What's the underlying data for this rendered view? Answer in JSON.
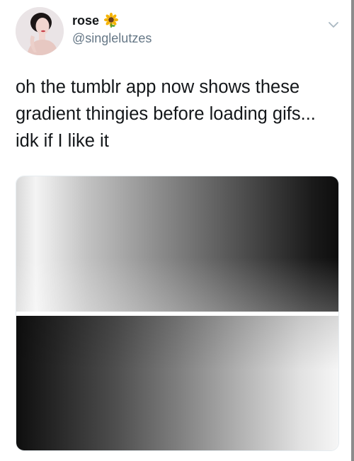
{
  "tweet": {
    "author": {
      "display_name": "rose",
      "name_emoji": "sunflower",
      "handle": "@singlelutzes"
    },
    "text": "oh the tumblr app now shows these\ngradient thingies before loading gifs...\nidk if I like it",
    "menu_icon": "chevron-down-icon"
  },
  "colors": {
    "text": "#14171a",
    "secondary_text": "#657786",
    "border": "#e6ecf0"
  }
}
